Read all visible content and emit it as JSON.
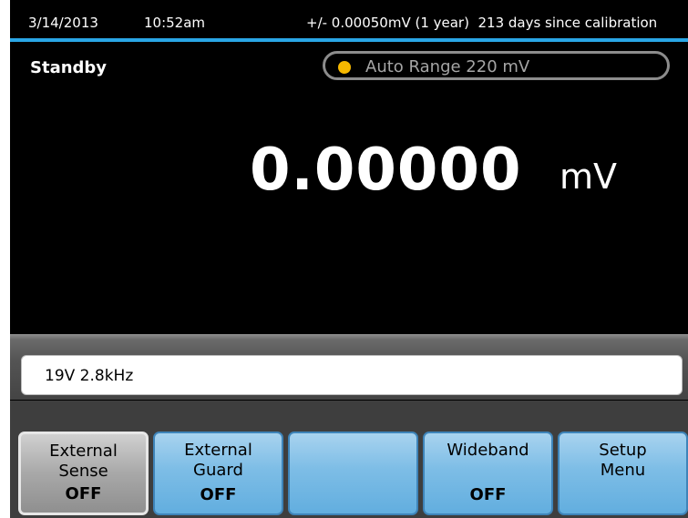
{
  "status_bar": {
    "date": "3/14/2013",
    "time": "10:52am",
    "info": "+/- 0.00050mV (1 year)  213 days since calibration",
    "accent_color": "#2aa6e6"
  },
  "display": {
    "mode": "Standby",
    "range_label": "Auto Range 220 mV",
    "range_indicator_color": "#f6b800",
    "reading": "0.00000",
    "unit": "mV"
  },
  "secondary": {
    "value": "19V 2.8kHz"
  },
  "softkeys": [
    {
      "line1": "External",
      "line2": "Sense",
      "state": "OFF",
      "active": true
    },
    {
      "line1": "External",
      "line2": "Guard",
      "state": "OFF",
      "active": false
    },
    {
      "line1": "",
      "line2": "",
      "state": "",
      "active": false
    },
    {
      "line1": "Wideband",
      "line2": "",
      "state": "OFF",
      "active": false
    },
    {
      "line1": "Setup",
      "line2": "Menu",
      "state": "",
      "active": false
    }
  ]
}
